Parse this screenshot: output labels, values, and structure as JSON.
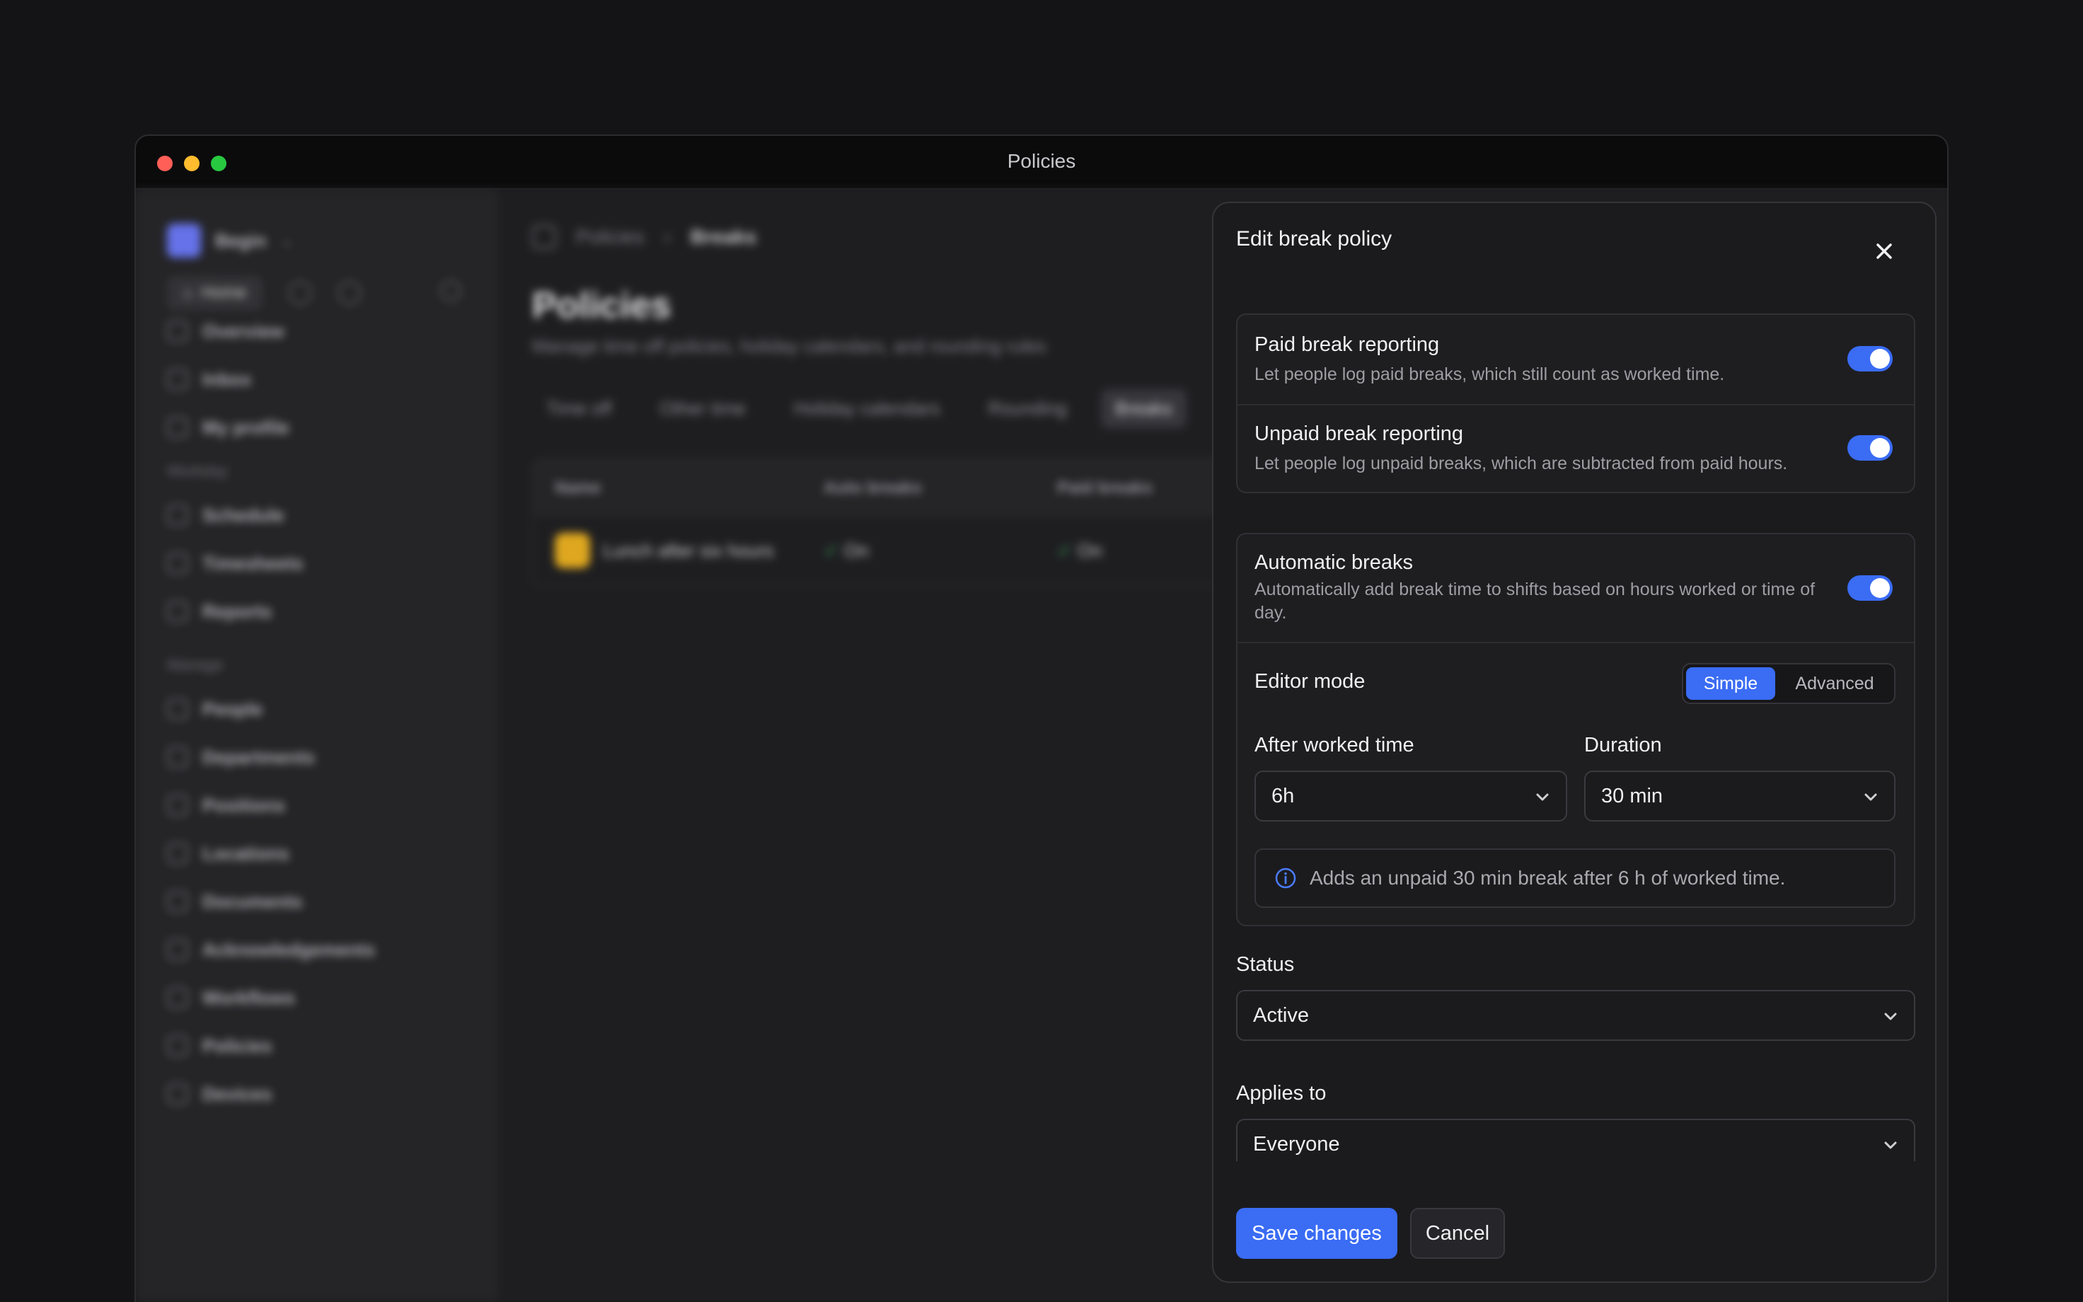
{
  "window": {
    "title": "Policies"
  },
  "background": {
    "workspace": "Begin",
    "quick_home": "Home",
    "nav_main": [
      "Overview",
      "Inbox",
      "My profile"
    ],
    "section_workday": "Workday",
    "nav_workday": [
      "Schedule",
      "Timesheets",
      "Reports"
    ],
    "section_manage": "Manage",
    "nav_manage": [
      "People",
      "Departments",
      "Positions",
      "Locations",
      "Documents",
      "Acknowledgements",
      "Workflows",
      "Policies",
      "Devices"
    ],
    "breadcrumb": [
      "Policies",
      "Breaks"
    ],
    "page_title": "Policies",
    "page_subtitle": "Manage time off policies, holiday calendars, and rounding rules",
    "tabs": [
      "Time off",
      "Other time",
      "Holiday calendars",
      "Rounding",
      "Breaks"
    ],
    "table": {
      "headers": [
        "Name",
        "Auto breaks",
        "Paid breaks"
      ],
      "row": {
        "name": "Lunch after six hours",
        "auto": "On",
        "paid": "On"
      }
    }
  },
  "dialog": {
    "title": "Edit break policy",
    "paid": {
      "title": "Paid break reporting",
      "desc": "Let people log paid breaks, which still count as worked time.",
      "on": true
    },
    "unpaid": {
      "title": "Unpaid break reporting",
      "desc": "Let people log unpaid breaks, which are subtracted from paid hours.",
      "on": true
    },
    "auto": {
      "title": "Automatic breaks",
      "desc": "Automatically add break time to shifts based on hours worked or time of day.",
      "on": true
    },
    "editor_mode": {
      "label": "Editor mode",
      "options": [
        "Simple",
        "Advanced"
      ],
      "selected": "Simple"
    },
    "after_worked": {
      "label": "After worked time",
      "value": "6h"
    },
    "duration": {
      "label": "Duration",
      "value": "30 min"
    },
    "info": "Adds an unpaid 30 min break after 6 h of worked time.",
    "status": {
      "label": "Status",
      "value": "Active"
    },
    "applies_to": {
      "label": "Applies to",
      "value": "Everyone"
    },
    "save": "Save changes",
    "cancel": "Cancel"
  },
  "colors": {
    "accent": "#3a6cf4",
    "background": "#141416",
    "panel": "#1b1b1e"
  }
}
